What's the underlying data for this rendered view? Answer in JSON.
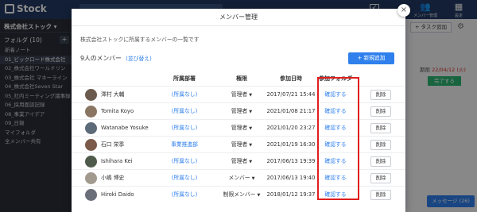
{
  "app": {
    "logo": "Stock",
    "header_items": [
      {
        "icon": "people-icon",
        "label": "メンバー管理"
      },
      {
        "icon": "settings-icon",
        "label": "設定"
      }
    ],
    "check_icon_glyph": "✓"
  },
  "sidebar": {
    "company": "株式会社ストック ▾",
    "folder_header": "フォルダ (10)",
    "folder_add": "+",
    "items": [
      "新着ノート",
      "01_ビックロード株式会社",
      "02_株式会社ワールドリン",
      "03_株式会社 マネーライン",
      "04_株式会社Seven Star",
      "05_社内ミーティング議事録",
      "06_採用面談記録",
      "08_事業アイデア",
      "09_日報",
      "マイフォルダ",
      "全メンバー共有"
    ]
  },
  "background": {
    "task_button": "+ タスク追加",
    "deadline_label": "期限",
    "deadline_date": "22/04/12 (火)",
    "done_button": "完了する",
    "message_button": "メッセージ (26)"
  },
  "modal": {
    "title": "メンバー管理",
    "close_glyph": "×",
    "description": "株式会社ストックに所属するメンバーの一覧です",
    "member_count": "9人のメンバー",
    "sort_link": "(並び替え)",
    "add_button": "+ 新規追加",
    "columns": {
      "dept": "所属部署",
      "role": "権限",
      "date": "参加日時",
      "folder": "参加フォルダ"
    },
    "members": [
      {
        "name": "澤村 大輔",
        "dept": "(所属なし)",
        "role": "管理者",
        "date": "2017/07/21 15:44",
        "folder": "確認する",
        "delete": "削除",
        "avatar_color": "#6b5a4e"
      },
      {
        "name": "Tomita Koyo",
        "dept": "(所属なし)",
        "role": "管理者",
        "date": "2021/01/08 21:17",
        "folder": "確認する",
        "delete": "削除",
        "avatar_color": "#8a7663"
      },
      {
        "name": "Watanabe Yosuke",
        "dept": "(所属なし)",
        "role": "管理者",
        "date": "2021/01/20 23:27",
        "folder": "確認する",
        "delete": "削除",
        "avatar_color": "#5d6a78"
      },
      {
        "name": "石口 栄季",
        "dept": "事業推進部",
        "role": "管理者",
        "date": "2021/01/19 16:30",
        "folder": "確認する",
        "delete": "削除",
        "avatar_color": "#7b5a4a"
      },
      {
        "name": "Ishihara Kei",
        "dept": "(所属なし)",
        "role": "管理者",
        "date": "2017/06/13 19:39",
        "folder": "確認する",
        "delete": "削除",
        "avatar_color": "#4f5b4a"
      },
      {
        "name": "小嶋 博史",
        "dept": "(所属なし)",
        "role": "メンバー",
        "date": "2017/06/13 19:40",
        "folder": "確認する",
        "delete": "削除",
        "avatar_color": "#a29a8e"
      },
      {
        "name": "Hiroki Daido",
        "dept": "(所属なし)",
        "role": "制限メンバー",
        "date": "2018/01/12 19:37",
        "folder": "確認する",
        "delete": "削除",
        "avatar_color": "#6a6f7a"
      }
    ]
  },
  "colors": {
    "accent": "#2f80ed",
    "highlight_border": "#e01e1e",
    "header_bg": "#213a63",
    "sidebar_bg": "#2a2f39"
  }
}
